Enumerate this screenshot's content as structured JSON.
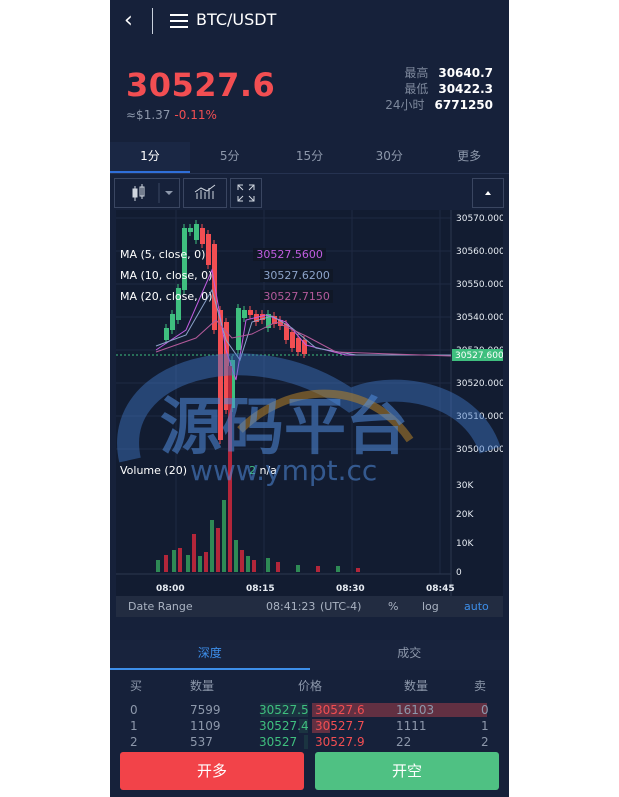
{
  "header": {
    "back_label": "‹",
    "pair": "BTC/USDT"
  },
  "ticker": {
    "price": "30527.6",
    "usd": "≈$1.37",
    "change": "-0.11%",
    "stats": [
      {
        "k": "最高",
        "v": "30640.7"
      },
      {
        "k": "最低",
        "v": "30422.3"
      },
      {
        "k": "24小时",
        "v": "6771250"
      }
    ]
  },
  "intervals": [
    "1分",
    "5分",
    "15分",
    "30分",
    "更多"
  ],
  "chart": {
    "ma": [
      {
        "label": "MA (5, close, 0)",
        "value": "30527.5600",
        "color": "#c05de0"
      },
      {
        "label": "MA (10, close, 0)",
        "value": "30527.6200",
        "color": "#8ca3c9"
      },
      {
        "label": "MA (20, close, 0)",
        "value": "30527.7150",
        "color": "#b35a9a"
      }
    ],
    "y_ticks": [
      "30570.0000",
      "30560.0000",
      "30550.0000",
      "30540.0000",
      "30530.0000",
      "30520.0000",
      "30510.0000",
      "30500.0000"
    ],
    "last_price": "30527.6000",
    "volume_label": "Volume (20)",
    "volume_value": "n/a",
    "volume_prefix": "2",
    "vol_ticks": [
      "30K",
      "20K",
      "10K",
      "0"
    ],
    "x_ticks": [
      "08:00",
      "08:15",
      "08:30",
      "08:45"
    ],
    "range": {
      "label": "Date Range",
      "time": "08:41:23",
      "tz": "(UTC-4)",
      "pct": "%",
      "log": "log",
      "auto": "auto"
    }
  },
  "watermark": {
    "text": "源码平台",
    "url": "www.ympt.cc"
  },
  "depth": {
    "tabs": [
      "深度",
      "成交"
    ],
    "headers": {
      "buy": "买",
      "qty": "数量",
      "price": "价格",
      "qty2": "数量",
      "sell": "卖"
    },
    "rows": [
      {
        "idx": "0",
        "bq": "7599",
        "bp": "30527.5",
        "ap": "30527.6",
        "aq": "16103",
        "ai": "0",
        "bfill": 0.55,
        "afill": 1.0
      },
      {
        "idx": "1",
        "bq": "1109",
        "bp": "30527.4",
        "ap": "30527.7",
        "aq": "1111",
        "ai": "1",
        "bfill": 0.1,
        "afill": 0.1
      },
      {
        "idx": "2",
        "bq": "537",
        "bp": "30527",
        "ap": "30527.9",
        "aq": "22",
        "ai": "2",
        "bfill": 0.05,
        "afill": 0.0
      }
    ]
  },
  "actions": {
    "long": "开多",
    "short": "开空"
  },
  "colors": {
    "up": "#3fbf7f",
    "down": "#f24e52",
    "bg": "#16213a",
    "accent": "#3d8ee9"
  }
}
